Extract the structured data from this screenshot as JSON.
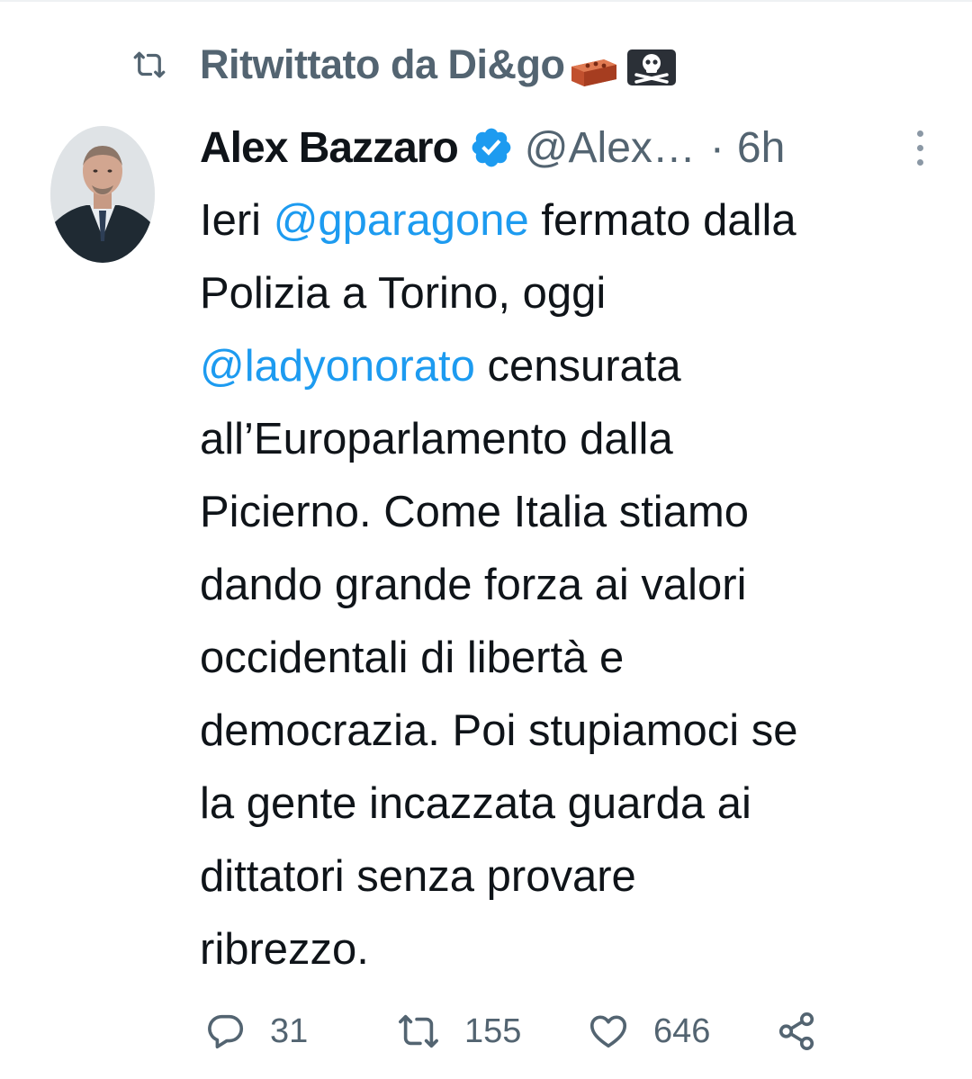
{
  "retweet": {
    "icon": "retweet-icon",
    "label": "Ritwittato da Di&go",
    "emojis": [
      "brick-emoji",
      "skull-crossbones-emoji"
    ]
  },
  "tweet": {
    "author_name": "Alex Bazzaro",
    "verified_icon": "verified-badge-icon",
    "handle": "@Alex…",
    "separator": "·",
    "time": "6h",
    "more_icon": "more-vertical-icon",
    "body": {
      "l1_pre": "Ieri ",
      "l1_mention": "@gparagone",
      "l1_post": " fermato dalla",
      "l2": "Polizia a Torino, oggi",
      "l3_mention": "@ladyonorato",
      "l3_post": " censurata",
      "l4": "all’Europarlamento dalla",
      "l5": "Picierno. Come Italia stiamo",
      "l6": "dando grande forza ai valori",
      "l7": "occidentali di libertà e",
      "l8": "democrazia. Poi stupiamoci se",
      "l9": "la gente incazzata guarda ai",
      "l10": "dittatori senza provare",
      "l11": "ribrezzo."
    },
    "actions": {
      "reply_icon": "reply-icon",
      "reply_count": "31",
      "retweet_icon": "retweet-icon",
      "retweet_count": "155",
      "like_icon": "heart-icon",
      "like_count": "646",
      "share_icon": "share-icon"
    }
  },
  "colors": {
    "text": "#0f1419",
    "secondary": "#536471",
    "link": "#1d9bf0",
    "verified": "#1d9bf0"
  }
}
